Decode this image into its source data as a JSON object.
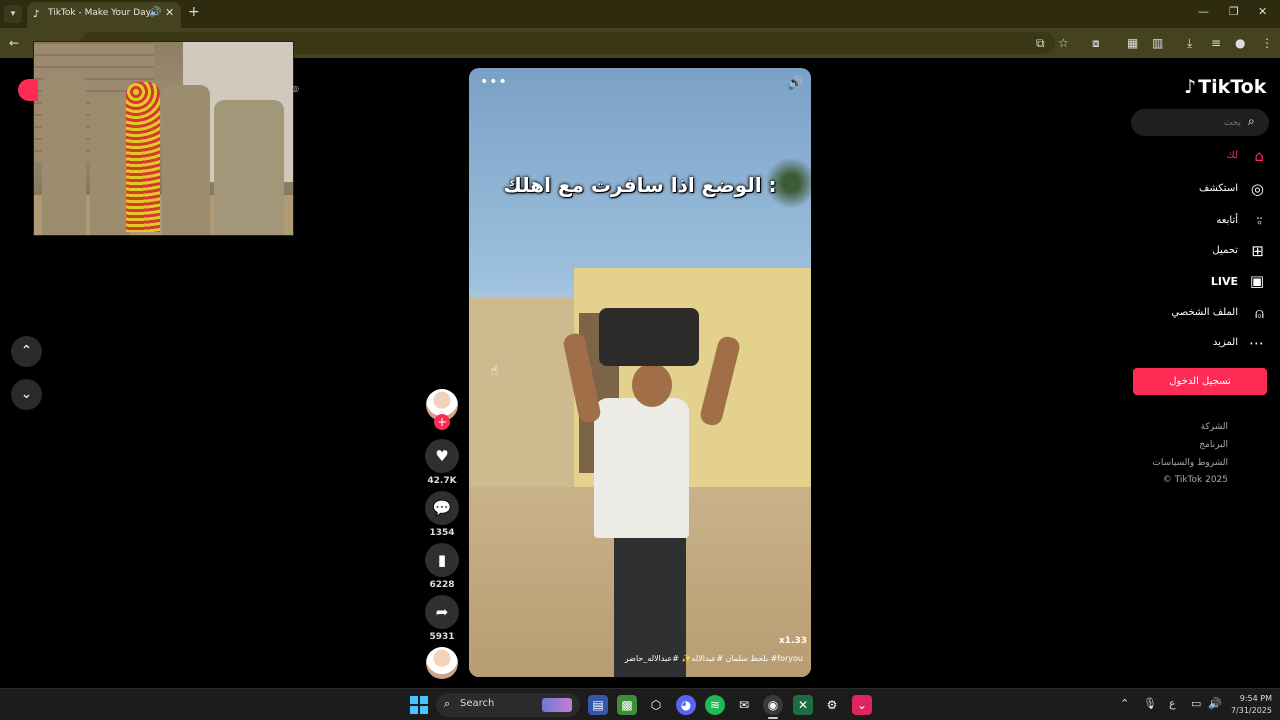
{
  "browser": {
    "tab_title": "TikTok - Make Your Day",
    "tab_favicon": "♪",
    "address_placeholder": ""
  },
  "tiktok": {
    "logo": "TikTok",
    "search_placeholder": "بحث",
    "nav": [
      {
        "label": "لك",
        "icon": "home-icon",
        "active": true
      },
      {
        "label": "استكشف",
        "icon": "compass-icon",
        "active": false
      },
      {
        "label": "أتابعه",
        "icon": "user-add-icon",
        "active": false
      },
      {
        "label": "تحميل",
        "icon": "upload-icon",
        "active": false
      },
      {
        "label": "LIVE",
        "icon": "live-icon",
        "active": false
      },
      {
        "label": "الملف الشخصي",
        "icon": "profile-icon",
        "active": false
      },
      {
        "label": "المزيد",
        "icon": "more-icon",
        "active": false
      }
    ],
    "login_label": "تسجيل الدخول",
    "footer": [
      "الشركة",
      "البرنامج",
      "الشروط والسياسات",
      "TikTok 2025 ©"
    ]
  },
  "video": {
    "caption": "الوضع اذا سافرت مع اهلك :",
    "speed": "x1.33",
    "tags": "بلحظ سلمان #عبدالاله✨ #عبدالاله_حاضر #foryou",
    "likes": "42.7K",
    "comments": "1354",
    "saves": "6228",
    "shares": "5931"
  },
  "taskbar": {
    "search_label": "Search",
    "time": "9:54 PM",
    "date": "7/31/2025",
    "ime": "ع"
  },
  "colors": {
    "accent": "#fe2c55",
    "chrome_frame": "#2e2b0f",
    "chrome_toolbar": "#45431f"
  }
}
